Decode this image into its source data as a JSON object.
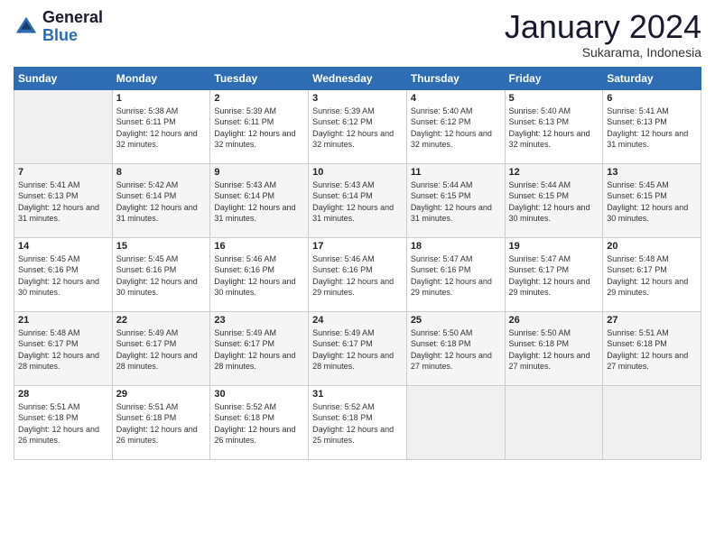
{
  "logo": {
    "general": "General",
    "blue": "Blue"
  },
  "header": {
    "month": "January 2024",
    "location": "Sukarama, Indonesia"
  },
  "days_header": [
    "Sunday",
    "Monday",
    "Tuesday",
    "Wednesday",
    "Thursday",
    "Friday",
    "Saturday"
  ],
  "weeks": [
    [
      {
        "day": "",
        "sunrise": "",
        "sunset": "",
        "daylight": ""
      },
      {
        "day": "1",
        "sunrise": "Sunrise: 5:38 AM",
        "sunset": "Sunset: 6:11 PM",
        "daylight": "Daylight: 12 hours and 32 minutes."
      },
      {
        "day": "2",
        "sunrise": "Sunrise: 5:39 AM",
        "sunset": "Sunset: 6:11 PM",
        "daylight": "Daylight: 12 hours and 32 minutes."
      },
      {
        "day": "3",
        "sunrise": "Sunrise: 5:39 AM",
        "sunset": "Sunset: 6:12 PM",
        "daylight": "Daylight: 12 hours and 32 minutes."
      },
      {
        "day": "4",
        "sunrise": "Sunrise: 5:40 AM",
        "sunset": "Sunset: 6:12 PM",
        "daylight": "Daylight: 12 hours and 32 minutes."
      },
      {
        "day": "5",
        "sunrise": "Sunrise: 5:40 AM",
        "sunset": "Sunset: 6:13 PM",
        "daylight": "Daylight: 12 hours and 32 minutes."
      },
      {
        "day": "6",
        "sunrise": "Sunrise: 5:41 AM",
        "sunset": "Sunset: 6:13 PM",
        "daylight": "Daylight: 12 hours and 31 minutes."
      }
    ],
    [
      {
        "day": "7",
        "sunrise": "Sunrise: 5:41 AM",
        "sunset": "Sunset: 6:13 PM",
        "daylight": "Daylight: 12 hours and 31 minutes."
      },
      {
        "day": "8",
        "sunrise": "Sunrise: 5:42 AM",
        "sunset": "Sunset: 6:14 PM",
        "daylight": "Daylight: 12 hours and 31 minutes."
      },
      {
        "day": "9",
        "sunrise": "Sunrise: 5:43 AM",
        "sunset": "Sunset: 6:14 PM",
        "daylight": "Daylight: 12 hours and 31 minutes."
      },
      {
        "day": "10",
        "sunrise": "Sunrise: 5:43 AM",
        "sunset": "Sunset: 6:14 PM",
        "daylight": "Daylight: 12 hours and 31 minutes."
      },
      {
        "day": "11",
        "sunrise": "Sunrise: 5:44 AM",
        "sunset": "Sunset: 6:15 PM",
        "daylight": "Daylight: 12 hours and 31 minutes."
      },
      {
        "day": "12",
        "sunrise": "Sunrise: 5:44 AM",
        "sunset": "Sunset: 6:15 PM",
        "daylight": "Daylight: 12 hours and 30 minutes."
      },
      {
        "day": "13",
        "sunrise": "Sunrise: 5:45 AM",
        "sunset": "Sunset: 6:15 PM",
        "daylight": "Daylight: 12 hours and 30 minutes."
      }
    ],
    [
      {
        "day": "14",
        "sunrise": "Sunrise: 5:45 AM",
        "sunset": "Sunset: 6:16 PM",
        "daylight": "Daylight: 12 hours and 30 minutes."
      },
      {
        "day": "15",
        "sunrise": "Sunrise: 5:45 AM",
        "sunset": "Sunset: 6:16 PM",
        "daylight": "Daylight: 12 hours and 30 minutes."
      },
      {
        "day": "16",
        "sunrise": "Sunrise: 5:46 AM",
        "sunset": "Sunset: 6:16 PM",
        "daylight": "Daylight: 12 hours and 30 minutes."
      },
      {
        "day": "17",
        "sunrise": "Sunrise: 5:46 AM",
        "sunset": "Sunset: 6:16 PM",
        "daylight": "Daylight: 12 hours and 29 minutes."
      },
      {
        "day": "18",
        "sunrise": "Sunrise: 5:47 AM",
        "sunset": "Sunset: 6:16 PM",
        "daylight": "Daylight: 12 hours and 29 minutes."
      },
      {
        "day": "19",
        "sunrise": "Sunrise: 5:47 AM",
        "sunset": "Sunset: 6:17 PM",
        "daylight": "Daylight: 12 hours and 29 minutes."
      },
      {
        "day": "20",
        "sunrise": "Sunrise: 5:48 AM",
        "sunset": "Sunset: 6:17 PM",
        "daylight": "Daylight: 12 hours and 29 minutes."
      }
    ],
    [
      {
        "day": "21",
        "sunrise": "Sunrise: 5:48 AM",
        "sunset": "Sunset: 6:17 PM",
        "daylight": "Daylight: 12 hours and 28 minutes."
      },
      {
        "day": "22",
        "sunrise": "Sunrise: 5:49 AM",
        "sunset": "Sunset: 6:17 PM",
        "daylight": "Daylight: 12 hours and 28 minutes."
      },
      {
        "day": "23",
        "sunrise": "Sunrise: 5:49 AM",
        "sunset": "Sunset: 6:17 PM",
        "daylight": "Daylight: 12 hours and 28 minutes."
      },
      {
        "day": "24",
        "sunrise": "Sunrise: 5:49 AM",
        "sunset": "Sunset: 6:17 PM",
        "daylight": "Daylight: 12 hours and 28 minutes."
      },
      {
        "day": "25",
        "sunrise": "Sunrise: 5:50 AM",
        "sunset": "Sunset: 6:18 PM",
        "daylight": "Daylight: 12 hours and 27 minutes."
      },
      {
        "day": "26",
        "sunrise": "Sunrise: 5:50 AM",
        "sunset": "Sunset: 6:18 PM",
        "daylight": "Daylight: 12 hours and 27 minutes."
      },
      {
        "day": "27",
        "sunrise": "Sunrise: 5:51 AM",
        "sunset": "Sunset: 6:18 PM",
        "daylight": "Daylight: 12 hours and 27 minutes."
      }
    ],
    [
      {
        "day": "28",
        "sunrise": "Sunrise: 5:51 AM",
        "sunset": "Sunset: 6:18 PM",
        "daylight": "Daylight: 12 hours and 26 minutes."
      },
      {
        "day": "29",
        "sunrise": "Sunrise: 5:51 AM",
        "sunset": "Sunset: 6:18 PM",
        "daylight": "Daylight: 12 hours and 26 minutes."
      },
      {
        "day": "30",
        "sunrise": "Sunrise: 5:52 AM",
        "sunset": "Sunset: 6:18 PM",
        "daylight": "Daylight: 12 hours and 26 minutes."
      },
      {
        "day": "31",
        "sunrise": "Sunrise: 5:52 AM",
        "sunset": "Sunset: 6:18 PM",
        "daylight": "Daylight: 12 hours and 25 minutes."
      },
      {
        "day": "",
        "sunrise": "",
        "sunset": "",
        "daylight": ""
      },
      {
        "day": "",
        "sunrise": "",
        "sunset": "",
        "daylight": ""
      },
      {
        "day": "",
        "sunrise": "",
        "sunset": "",
        "daylight": ""
      }
    ]
  ]
}
